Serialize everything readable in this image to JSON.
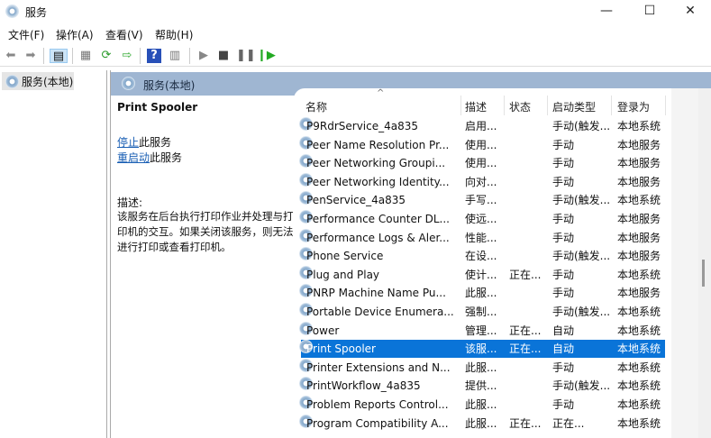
{
  "window": {
    "title": "服务",
    "min": "—",
    "max": "☐",
    "close": "✕"
  },
  "menu": [
    "文件(F)",
    "操作(A)",
    "查看(V)",
    "帮助(H)"
  ],
  "tree": {
    "root": "服务(本地)"
  },
  "header": {
    "title": "服务(本地)"
  },
  "detail": {
    "name": "Print Spooler",
    "stop_link": "停止",
    "stop_suffix": "此服务",
    "restart_link": "重启动",
    "restart_suffix": "此服务",
    "desc_label": "描述:",
    "desc_text": "该服务在后台执行打印作业并处理与打印机的交互。如果关闭该服务，则无法进行打印或查看打印机。"
  },
  "columns": [
    "名称",
    "描述",
    "状态",
    "启动类型",
    "登录为"
  ],
  "sort_indicator": "^",
  "rows": [
    [
      "P9RdrService_4a835",
      "启用...",
      "",
      "手动(触发...",
      "本地系统"
    ],
    [
      "Peer Name Resolution Pr...",
      "使用...",
      "",
      "手动",
      "本地服务"
    ],
    [
      "Peer Networking Groupi...",
      "使用...",
      "",
      "手动",
      "本地服务"
    ],
    [
      "Peer Networking Identity...",
      "向对...",
      "",
      "手动",
      "本地服务"
    ],
    [
      "PenService_4a835",
      "手写...",
      "",
      "手动(触发...",
      "本地系统"
    ],
    [
      "Performance Counter DL...",
      "使远...",
      "",
      "手动",
      "本地服务"
    ],
    [
      "Performance Logs & Aler...",
      "性能...",
      "",
      "手动",
      "本地服务"
    ],
    [
      "Phone Service",
      "在设...",
      "",
      "手动(触发...",
      "本地服务"
    ],
    [
      "Plug and Play",
      "使计...",
      "正在...",
      "手动",
      "本地系统"
    ],
    [
      "PNRP Machine Name Pu...",
      "此服...",
      "",
      "手动",
      "本地服务"
    ],
    [
      "Portable Device Enumera...",
      "强制...",
      "",
      "手动(触发...",
      "本地系统"
    ],
    [
      "Power",
      "管理...",
      "正在...",
      "自动",
      "本地系统"
    ],
    [
      "Print Spooler",
      "该服...",
      "正在...",
      "自动",
      "本地系统"
    ],
    [
      "Printer Extensions and N...",
      "此服...",
      "",
      "手动",
      "本地系统"
    ],
    [
      "PrintWorkflow_4a835",
      "提供...",
      "",
      "手动(触发...",
      "本地系统"
    ],
    [
      "Problem Reports Control...",
      "此服...",
      "",
      "手动",
      "本地系统"
    ],
    [
      "Program Compatibility A...",
      "此服...",
      "正在...",
      "正在...",
      "本地系统"
    ]
  ],
  "selected_row": 12
}
